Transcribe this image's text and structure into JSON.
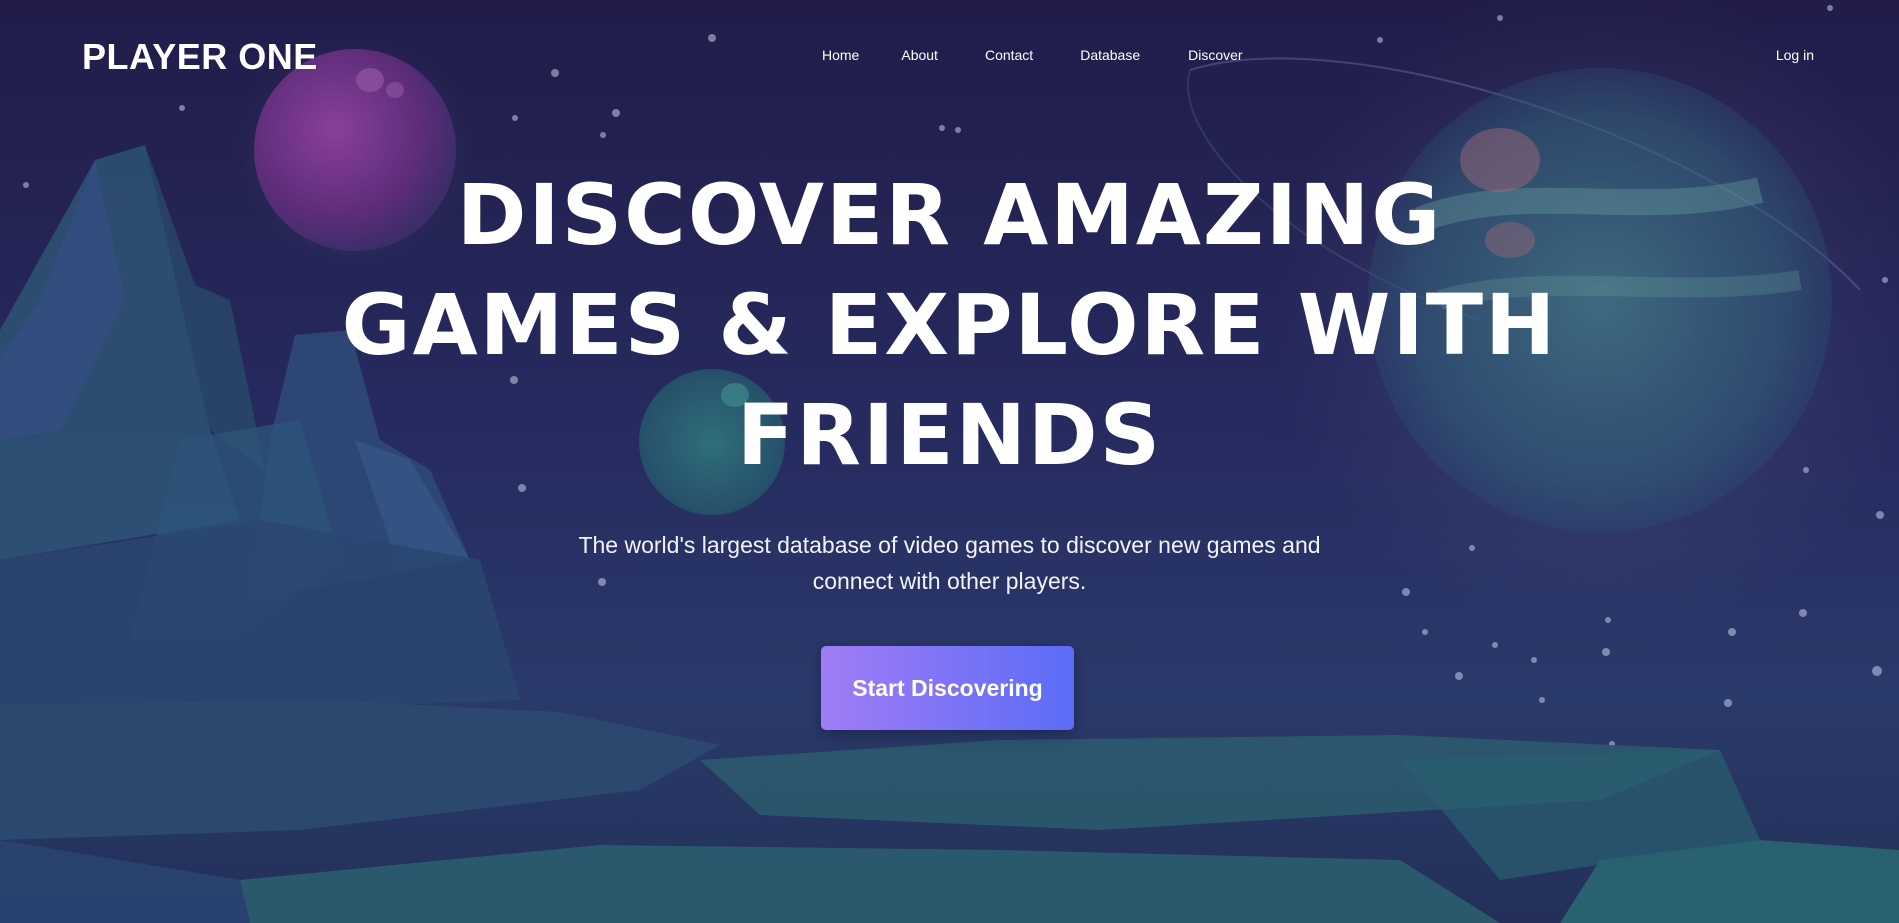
{
  "header": {
    "logo": "PLAYER ONE",
    "nav": [
      {
        "label": "Home"
      },
      {
        "label": "About"
      },
      {
        "label": "Contact"
      },
      {
        "label": "Database"
      },
      {
        "label": "Discover"
      }
    ],
    "login_label": "Log in"
  },
  "hero": {
    "title_lines": [
      "DISCOVER AMAZING",
      "GAMES & EXPLORE WITH",
      "FRIENDS"
    ],
    "subtitle_lines": [
      "The world's largest database of video games to discover new games and",
      "connect with other players."
    ],
    "cta_label": "Start Discovering"
  },
  "colors": {
    "background": "#232152",
    "cta_gradient_start": "#a17cf5",
    "cta_gradient_end": "#5b6cf7",
    "text": "#ffffff"
  }
}
